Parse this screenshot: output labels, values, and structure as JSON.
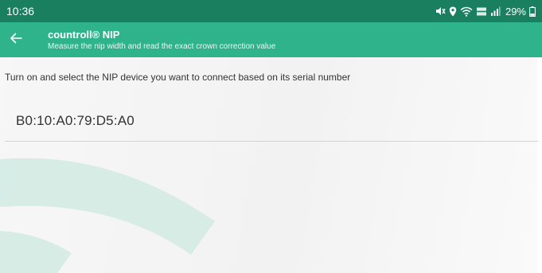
{
  "status_bar": {
    "time": "10:36",
    "battery_percent": "29%",
    "icons": [
      "mute-icon",
      "location-icon",
      "wifi-icon",
      "volte-icon",
      "signal-icon",
      "battery-icon"
    ],
    "color": "#1a7f5f"
  },
  "app_bar": {
    "title": "countroll® NIP",
    "subtitle": "Measure the nip width and read the exact crown correction value",
    "back_icon": "arrow-left-icon",
    "color": "#2fb38b"
  },
  "content": {
    "instruction": "Turn on and select the NIP device you want to connect based on its serial number",
    "devices": [
      {
        "serial": "B0:10:A0:79:D5:A0"
      }
    ]
  },
  "decoration": {
    "accent_color": "#cfe9e1",
    "icon": "wifi-signal-watermark-icon"
  }
}
